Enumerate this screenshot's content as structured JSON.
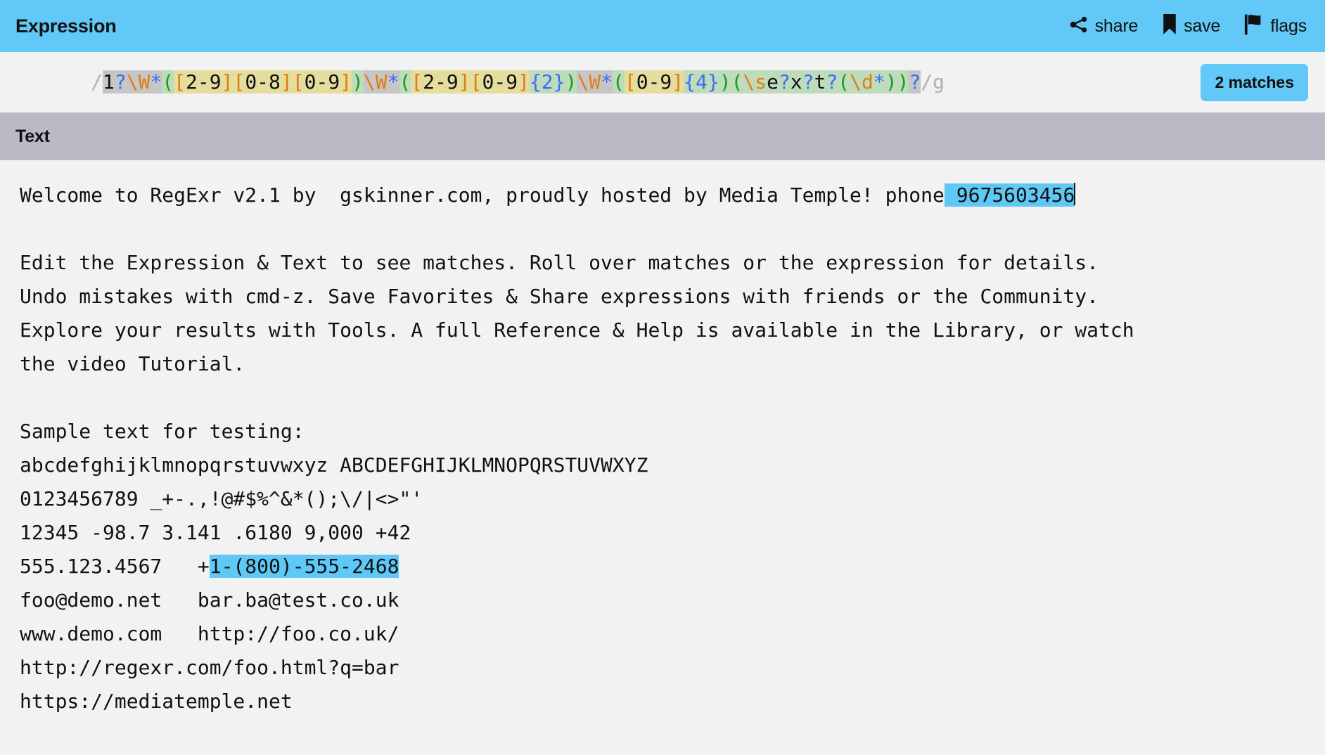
{
  "header": {
    "title": "Expression",
    "actions": [
      {
        "label": "share",
        "icon": "share-icon"
      },
      {
        "label": "save",
        "icon": "bookmark-icon"
      },
      {
        "label": "flags",
        "icon": "flag-icon"
      }
    ]
  },
  "expression": {
    "full": "/1?\\W*([2-9][0-8][0-9])\\W*([2-9][0-9]{2})\\W*([0-9]{4})(\\se?x?t?(\\d*))?/g",
    "open_delimiter": "/",
    "close_delimiter": "/",
    "flags": "g",
    "tokens": [
      {
        "t": "1",
        "c": "lit",
        "bg": "track"
      },
      {
        "t": "?",
        "c": "quant",
        "bg": "track"
      },
      {
        "t": "\\W",
        "c": "esc",
        "bg": "track"
      },
      {
        "t": "*",
        "c": "quant",
        "bg": "track"
      },
      {
        "t": "(",
        "c": "group",
        "bg": "group"
      },
      {
        "t": "[",
        "c": "set",
        "bg": "set"
      },
      {
        "t": "2-9",
        "c": "lit",
        "bg": "set"
      },
      {
        "t": "]",
        "c": "set",
        "bg": "set"
      },
      {
        "t": "[",
        "c": "set",
        "bg": "set"
      },
      {
        "t": "0-8",
        "c": "lit",
        "bg": "set"
      },
      {
        "t": "]",
        "c": "set",
        "bg": "set"
      },
      {
        "t": "[",
        "c": "set",
        "bg": "set"
      },
      {
        "t": "0-9",
        "c": "lit",
        "bg": "set"
      },
      {
        "t": "]",
        "c": "set",
        "bg": "set"
      },
      {
        "t": ")",
        "c": "group",
        "bg": "group"
      },
      {
        "t": "\\W",
        "c": "esc",
        "bg": "track"
      },
      {
        "t": "*",
        "c": "quant",
        "bg": "track"
      },
      {
        "t": "(",
        "c": "group",
        "bg": "group"
      },
      {
        "t": "[",
        "c": "set",
        "bg": "set"
      },
      {
        "t": "2-9",
        "c": "lit",
        "bg": "set"
      },
      {
        "t": "]",
        "c": "set",
        "bg": "set"
      },
      {
        "t": "[",
        "c": "set",
        "bg": "set"
      },
      {
        "t": "0-9",
        "c": "lit",
        "bg": "set"
      },
      {
        "t": "]",
        "c": "set",
        "bg": "set"
      },
      {
        "t": "{2}",
        "c": "quant",
        "bg": "group"
      },
      {
        "t": ")",
        "c": "group",
        "bg": "group"
      },
      {
        "t": "\\W",
        "c": "esc",
        "bg": "track"
      },
      {
        "t": "*",
        "c": "quant",
        "bg": "track"
      },
      {
        "t": "(",
        "c": "group",
        "bg": "group"
      },
      {
        "t": "[",
        "c": "set",
        "bg": "set"
      },
      {
        "t": "0-9",
        "c": "lit",
        "bg": "set"
      },
      {
        "t": "]",
        "c": "set",
        "bg": "set"
      },
      {
        "t": "{4}",
        "c": "quant",
        "bg": "group"
      },
      {
        "t": ")",
        "c": "group",
        "bg": "group"
      },
      {
        "t": "(",
        "c": "group",
        "bg": "group"
      },
      {
        "t": "\\s",
        "c": "esc",
        "bg": "group"
      },
      {
        "t": "e",
        "c": "lit",
        "bg": "group"
      },
      {
        "t": "?",
        "c": "quant",
        "bg": "group"
      },
      {
        "t": "x",
        "c": "lit",
        "bg": "group"
      },
      {
        "t": "?",
        "c": "quant",
        "bg": "group"
      },
      {
        "t": "t",
        "c": "lit",
        "bg": "group"
      },
      {
        "t": "?",
        "c": "quant",
        "bg": "group"
      },
      {
        "t": "(",
        "c": "group",
        "bg": "group2"
      },
      {
        "t": "\\d",
        "c": "esc",
        "bg": "group2"
      },
      {
        "t": "*",
        "c": "quant",
        "bg": "group2"
      },
      {
        "t": ")",
        "c": "group",
        "bg": "group2"
      },
      {
        "t": ")",
        "c": "group",
        "bg": "group"
      },
      {
        "t": "?",
        "c": "quant",
        "bg": "track"
      }
    ],
    "match_count_label": "2 matches"
  },
  "text_panel": {
    "title": "Text",
    "segments": [
      {
        "text": "Welcome to RegExr v2.1 by  gskinner.com, proudly hosted by Media Temple! phone",
        "match": false
      },
      {
        "text": " 9675603456",
        "match": true
      },
      {
        "text": "",
        "caret": true
      },
      {
        "text": "\n\nEdit the Expression & Text to see matches. Roll over matches or the expression for details.\nUndo mistakes with cmd-z. Save Favorites & Share expressions with friends or the Community.\nExplore your results with Tools. A full Reference & Help is available in the Library, or watch\nthe video Tutorial.\n\nSample text for testing:\nabcdefghijklmnopqrstuvwxyz ABCDEFGHIJKLMNOPQRSTUVWXYZ\n0123456789 _+-.,!@#$%^&*();\\/|<>\"'\n12345 -98.7 3.141 .6180 9,000 +42\n555.123.4567   +",
        "match": false
      },
      {
        "text": "1-(800)-555-2468",
        "match": true
      },
      {
        "text": "\nfoo@demo.net   bar.ba@test.co.uk\nwww.demo.com   http://foo.co.uk/\nhttp://regexr.com/foo.html?q=bar\nhttps://mediatemple.net",
        "match": false
      }
    ],
    "matches": [
      "9675603456",
      "1-(800)-555-2468"
    ]
  },
  "colors": {
    "brand_blue": "#62c8f7",
    "panel_gray": "#f2f2f2",
    "text_bar": "#b9bac6",
    "highlight": "#5ec8f7",
    "token_escape": "#e07b15",
    "token_quantifier": "#3b6ef5",
    "token_group": "#1a9e1a",
    "token_literal": "#111111",
    "bg_track": "#c6c6c6",
    "bg_set": "#e5dd9d",
    "bg_group": "#bedcbc"
  }
}
